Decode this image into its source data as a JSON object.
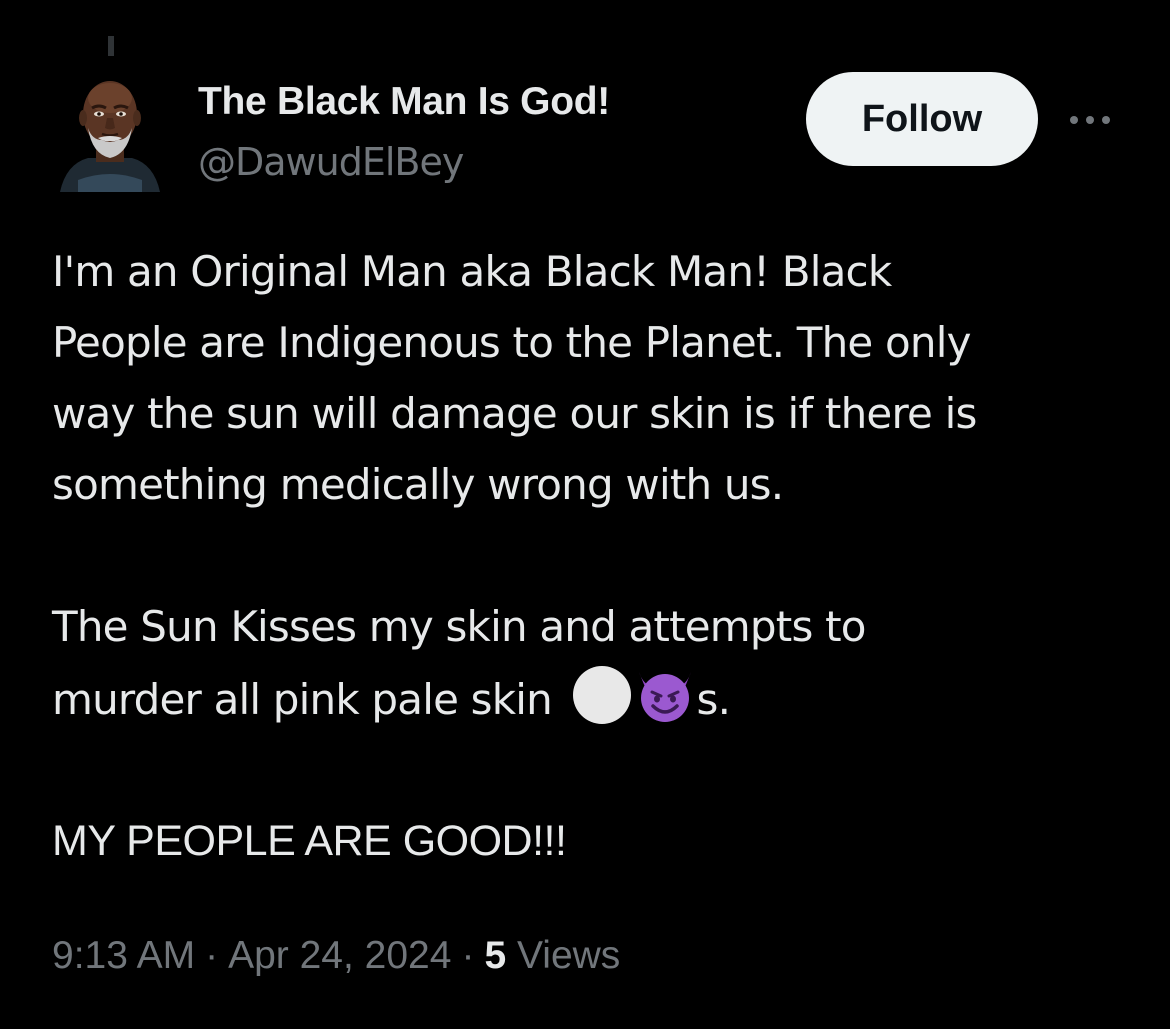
{
  "author": {
    "display_name": "The Black Man Is God!",
    "handle": "@DawudElBey",
    "avatar_icon": "avatar-portrait"
  },
  "follow_button": {
    "label": "Follow"
  },
  "more_menu": {
    "icon": "more-horizontal-icon"
  },
  "tweet": {
    "paragraph_1": "I'm an Original Man aka Black Man! Black\nPeople are Indigenous to the Planet. The only\nway the sun will damage our skin is if there is\nsomething medically wrong with us.",
    "paragraph_2_text": "The Sun Kisses my skin and attempts to\nmurder all pink pale skin ",
    "paragraph_2_emojis": [
      "white-circle-emoji",
      "smiling-devil-emoji"
    ],
    "paragraph_2_suffix": "s.",
    "paragraph_3": "MY PEOPLE ARE GOOD!!!"
  },
  "meta": {
    "time": "9:13 AM",
    "separator": "·",
    "date": "Apr 24, 2024",
    "views_count": "5",
    "views_label": "Views"
  },
  "colors": {
    "background": "#000000",
    "primary_text": "#e7e9ea",
    "secondary_text": "#71767b",
    "follow_bg": "#eff3f4",
    "follow_text": "#0f1419",
    "devil_purple": "#9b59d0"
  }
}
